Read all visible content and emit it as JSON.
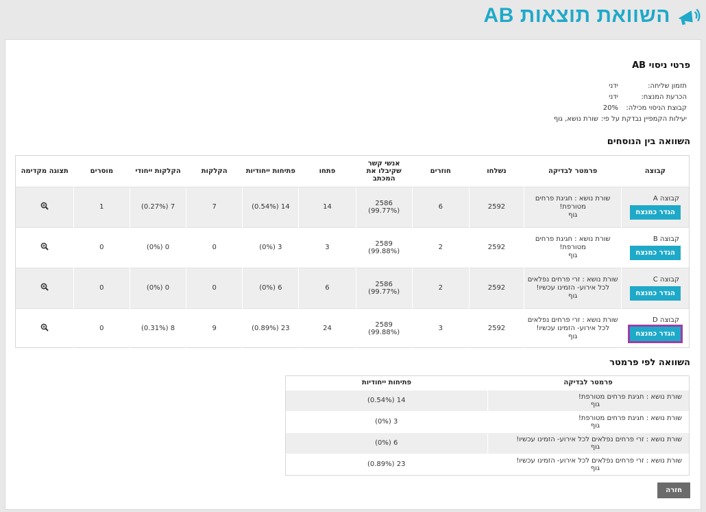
{
  "header": {
    "title": "השוואת תוצאות AB"
  },
  "details": {
    "heading": "פרטי ניסוי AB",
    "rows": [
      {
        "key": "תזמון שליחה:",
        "value": "ידני"
      },
      {
        "key": "הכרעת המנצח:",
        "value": "ידני"
      },
      {
        "key": "קבוצת הניסוי מכילה:",
        "value": "20%"
      },
      {
        "key": "יעילות הקמפיין נבדקת על פי:",
        "value": "שורת נושא, גוף"
      }
    ]
  },
  "comparison": {
    "heading": "השוואה בין הנוסחים",
    "columns": [
      "קבוצה",
      "פרמטר לבדיקה",
      "נשלחו",
      "חוזרים",
      "אנשי קשר שקיבלו את המכתב",
      "פתחו",
      "פתיחות ייחודיות",
      "הקלקות",
      "הקלקות ייחודי",
      "מוסרים",
      "תצוגה מקדימה"
    ],
    "button_label": "הגדר כמנצח",
    "rows": [
      {
        "group": "קבוצה A",
        "param_line1": "שורת נושא : חגיגת פרחים מטורפת!",
        "param_line2": "גוף",
        "sent": "2592",
        "returned": "6",
        "received": "2586 (99.77%)",
        "opened": "14",
        "unique_opens": "14 (0.54%)",
        "clicks": "7",
        "unique_clicks": "7 (0.27%)",
        "unsub": "1"
      },
      {
        "group": "קבוצה B",
        "param_line1": "שורת נושא : חגיגת פרחים מטורפת!",
        "param_line2": "גוף",
        "sent": "2592",
        "returned": "2",
        "received": "2589 (99.88%)",
        "opened": "3",
        "unique_opens": "3 (0%)",
        "clicks": "0",
        "unique_clicks": "0 (0%)",
        "unsub": "0"
      },
      {
        "group": "קבוצה C",
        "param_line1": "שורת נושא : זרי פרחים נפלאים לכל אירוע- הזמינו עכשיו!",
        "param_line2": "גוף",
        "sent": "2592",
        "returned": "2",
        "received": "2586 (99.77%)",
        "opened": "6",
        "unique_opens": "6 (0%)",
        "clicks": "0",
        "unique_clicks": "0 (0%)",
        "unsub": "0"
      },
      {
        "group": "קבוצה D",
        "param_line1": "שורת נושא : זרי פרחים נפלאים לכל אירוע- הזמינו עכשיו!",
        "param_line2": "גוף",
        "sent": "2592",
        "returned": "3",
        "received": "2589 (99.88%)",
        "opened": "24",
        "unique_opens": "23 (0.89%)",
        "clicks": "9",
        "unique_clicks": "8 (0.31%)",
        "unsub": "0"
      }
    ]
  },
  "by_param": {
    "heading": "השוואה לפי פרמטר",
    "columns": [
      "פרמטר לבדיקה",
      "פתיחות ייחודיות"
    ],
    "rows": [
      {
        "param_line1": "שורת נושא : חגיגת פרחים מטורפת!",
        "param_line2": "גוף",
        "unique_opens": "14 (0.54%)"
      },
      {
        "param_line1": "שורת נושא : חגיגת פרחים מטורפת!",
        "param_line2": "גוף",
        "unique_opens": "3 (0%)"
      },
      {
        "param_line1": "שורת נושא : זרי פרחים נפלאים לכל אירוע- הזמינו עכשיו!",
        "param_line2": "גוף",
        "unique_opens": "6 (0%)"
      },
      {
        "param_line1": "שורת נושא : זרי פרחים נפלאים לכל אירוע- הזמינו עכשיו!",
        "param_line2": "גוף",
        "unique_opens": "23 (0.89%)"
      }
    ]
  },
  "back_label": "חזרה",
  "colors": {
    "accent": "#1fa9c9",
    "highlight": "#9b3fa5",
    "back_button": "#6b6b6b"
  }
}
